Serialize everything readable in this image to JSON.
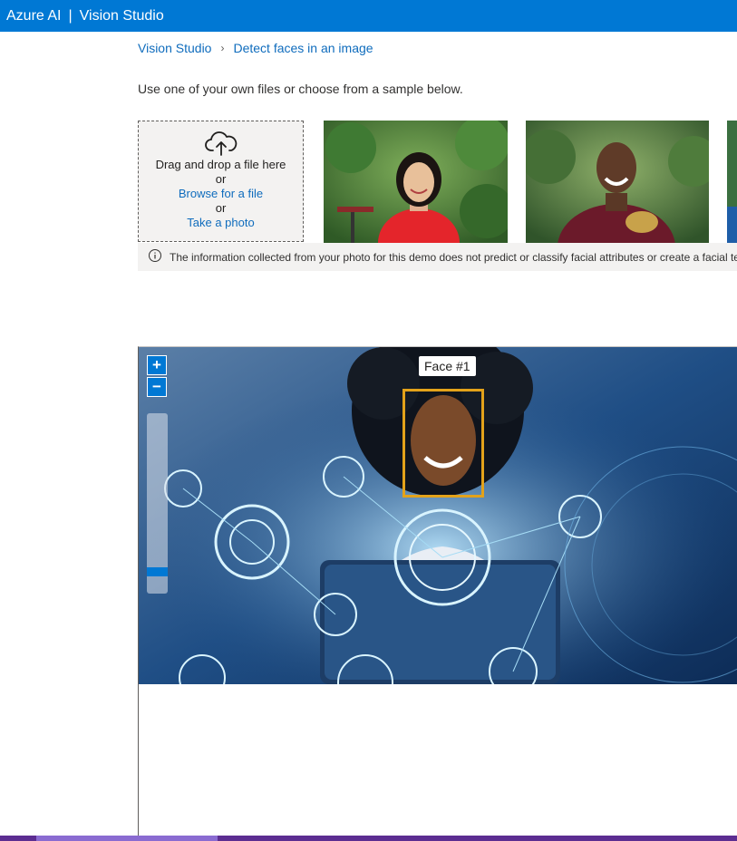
{
  "topbar": {
    "brand": "Azure AI",
    "separator": "|",
    "product": "Vision Studio"
  },
  "breadcrumb": {
    "items": [
      "Vision Studio",
      "Detect faces in an image"
    ]
  },
  "instructions": "Use one of your own files or choose from a sample below.",
  "upload": {
    "drag_text": "Drag and drop a file here",
    "or_1": "or",
    "browse_link": "Browse for a file",
    "or_2": "or",
    "photo_link": "Take a photo",
    "icon": "cloud-upload-icon"
  },
  "samples": [
    {
      "name": "sample-woman-red-shirt"
    },
    {
      "name": "sample-man-maroon-shirt"
    },
    {
      "name": "sample-partial"
    }
  ],
  "notice": {
    "icon": "info-icon",
    "text": "The information collected from your photo for this demo does not predict or classify facial attributes or create a facial template."
  },
  "viewer": {
    "zoom_in": "+",
    "zoom_out": "−",
    "zoom_level": 0.1,
    "face_label": "Face #1"
  },
  "colors": {
    "accent": "#0078d4",
    "link": "#0f6cbd",
    "face_box": "#e3a21a"
  }
}
